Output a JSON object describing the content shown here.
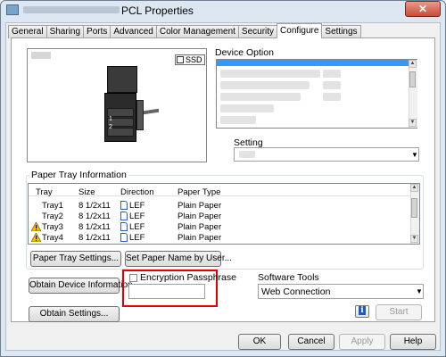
{
  "window": {
    "title": "PCL Properties",
    "close_glyph": "✕"
  },
  "tabs": [
    {
      "label": "General"
    },
    {
      "label": "Sharing"
    },
    {
      "label": "Ports"
    },
    {
      "label": "Advanced"
    },
    {
      "label": "Color Management"
    },
    {
      "label": "Security"
    },
    {
      "label": "Configure",
      "active": true
    },
    {
      "label": "Settings"
    }
  ],
  "preview": {
    "ssd_label": "SSD",
    "drawer_numbers": [
      "1",
      "2"
    ]
  },
  "device_option": {
    "label": "Device Option",
    "label_underline_char": "O"
  },
  "setting": {
    "label": "Setting",
    "label_underline_char": "S"
  },
  "paper_tray": {
    "group_label": "Paper Tray Information",
    "columns": [
      "Tray",
      "Size",
      "Direction",
      "Paper Type"
    ],
    "rows": [
      {
        "tray": "Tray1",
        "size": "8 1/2x11",
        "direction": "LEF",
        "paper_type": "Plain Paper",
        "warning": false
      },
      {
        "tray": "Tray2",
        "size": "8 1/2x11",
        "direction": "LEF",
        "paper_type": "Plain Paper",
        "warning": false
      },
      {
        "tray": "Tray3",
        "size": "8 1/2x11",
        "direction": "LEF",
        "paper_type": "Plain Paper",
        "warning": true
      },
      {
        "tray": "Tray4",
        "size": "8 1/2x11",
        "direction": "LEF",
        "paper_type": "Plain Paper",
        "warning": true
      }
    ],
    "settings_button": "Paper Tray Settings...",
    "set_name_button": "Set Paper Name by User..."
  },
  "buttons": {
    "obtain_device_info": "Obtain Device Information",
    "obtain_settings": "Obtain Settings...",
    "start": "Start",
    "ok": "OK",
    "cancel": "Cancel",
    "apply": "Apply",
    "help": "Help"
  },
  "encryption": {
    "label": "Encryption Passphrase",
    "checked": false,
    "value": ""
  },
  "software_tools": {
    "label": "Software Tools",
    "selected": "Web Connection"
  },
  "colors": {
    "selection": "#3399ff",
    "highlight_box": "#e00000",
    "warning": "#f2c200"
  }
}
